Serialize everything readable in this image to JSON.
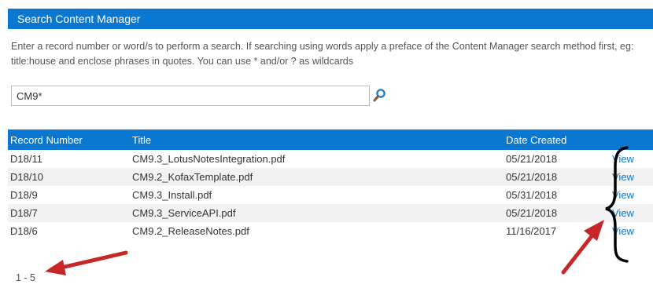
{
  "panel": {
    "title": "Search Content Manager"
  },
  "instructions": "Enter a record number or word/s to perform a search. If searching using words apply a preface of the Content Manager search method first, eg: title:house and enclose phrases in quotes. You can use * and/or ? as wildcards",
  "search": {
    "value": "CM9*",
    "icon": "search-icon"
  },
  "table": {
    "headers": {
      "record_number": "Record Number",
      "title": "Title",
      "date_created": "Date Created"
    },
    "rows": [
      {
        "record_number": "D18/11",
        "title": "CM9.3_LotusNotesIntegration.pdf",
        "date_created": "05/21/2018",
        "action": "View"
      },
      {
        "record_number": "D18/10",
        "title": "CM9.2_KofaxTemplate.pdf",
        "date_created": "05/21/2018",
        "action": "View"
      },
      {
        "record_number": "D18/9",
        "title": "CM9.3_Install.pdf",
        "date_created": "05/31/2018",
        "action": "View"
      },
      {
        "record_number": "D18/7",
        "title": "CM9.3_ServiceAPI.pdf",
        "date_created": "05/21/2018",
        "action": "View"
      },
      {
        "record_number": "D18/6",
        "title": "CM9.2_ReleaseNotes.pdf",
        "date_created": "11/16/2017",
        "action": "View"
      }
    ]
  },
  "pager": {
    "range": "1 - 5"
  },
  "colors": {
    "accent": "#0a78d1",
    "annotation_arrow": "#c62828",
    "annotation_brace": "#000000"
  }
}
